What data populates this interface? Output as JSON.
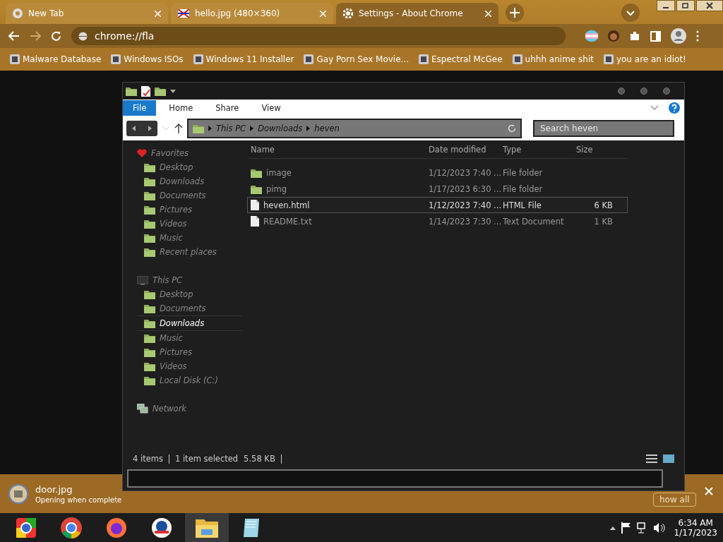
{
  "browser": {
    "tabs": [
      {
        "title": "New Tab",
        "kind": "chrome",
        "selected": false
      },
      {
        "title": "hello.jpg (480×360)",
        "kind": "flag",
        "selected": false
      },
      {
        "title": "Settings - About Chrome",
        "kind": "gear",
        "selected": true
      }
    ],
    "address": "chrome://fla",
    "bookmarks": [
      "Malware Database",
      "Windows ISOs",
      "Windows 11 Installer",
      "Gay Porn Sex Movie...",
      "Espectral McGee",
      "uhhh anime shit",
      "you are an idiot!"
    ]
  },
  "explorer": {
    "ribbon_tabs": [
      {
        "label": "File",
        "selected": true
      },
      {
        "label": "Home",
        "selected": false
      },
      {
        "label": "Share",
        "selected": false
      },
      {
        "label": "View",
        "selected": false
      }
    ],
    "breadcrumb": [
      "This PC",
      "Downloads",
      "heven"
    ],
    "search": {
      "placeholder": "Search heven"
    },
    "nav": [
      {
        "label": "Favorites",
        "kind": "favorites",
        "children": [
          {
            "label": "Desktop",
            "selected": false
          },
          {
            "label": "Downloads",
            "selected": false
          },
          {
            "label": "Documents",
            "selected": false
          },
          {
            "label": "Pictures",
            "selected": false
          },
          {
            "label": "Videos",
            "selected": false
          },
          {
            "label": "Music",
            "selected": false
          },
          {
            "label": "Recent places",
            "selected": false
          }
        ]
      },
      {
        "label": "This PC",
        "kind": "pc",
        "children": [
          {
            "label": "Desktop",
            "selected": false
          },
          {
            "label": "Documents",
            "selected": false
          },
          {
            "label": "Downloads",
            "selected": true
          },
          {
            "label": "Music",
            "selected": false
          },
          {
            "label": "Pictures",
            "selected": false
          },
          {
            "label": "Videos",
            "selected": false
          },
          {
            "label": "Local Disk (C:)",
            "selected": false
          }
        ]
      },
      {
        "label": "Network",
        "kind": "network"
      }
    ],
    "columns": [
      "Name",
      "Date modified",
      "Type",
      "Size"
    ],
    "rows": [
      {
        "kind": "folder",
        "name": "image",
        "date": "1/12/2023 7:40 ...",
        "type": "File folder",
        "size": "",
        "selected": false
      },
      {
        "kind": "folder",
        "name": "pimg",
        "date": "1/17/2023 6:30 ...",
        "type": "File folder",
        "size": "",
        "selected": false
      },
      {
        "kind": "file",
        "name": "heven.html",
        "date": "1/12/2023 7:40 ...",
        "type": "HTML File",
        "size": "6 KB",
        "selected": true
      },
      {
        "kind": "file",
        "name": "README.txt",
        "date": "1/14/2023 7:30 ...",
        "type": "Text Document",
        "size": "1 KB",
        "selected": false
      }
    ],
    "status": [
      "4 items",
      "1 item selected",
      "5.58 KB"
    ]
  },
  "download": {
    "file": "door.jpg",
    "status": "Opening when complete",
    "button": "how all"
  },
  "taskbar": {
    "apps": [
      {
        "kind": "chrome-alt",
        "selected": false
      },
      {
        "kind": "chrome",
        "selected": false
      },
      {
        "kind": "firefox",
        "selected": false
      },
      {
        "kind": "circle",
        "selected": false
      },
      {
        "kind": "folder",
        "selected": true
      },
      {
        "kind": "notepad",
        "selected": false
      }
    ],
    "time": "6:34 AM",
    "date": "1/17/2023"
  }
}
